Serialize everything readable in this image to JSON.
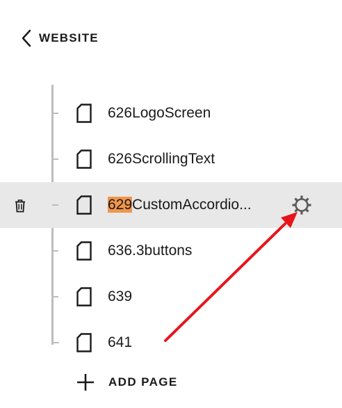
{
  "header": {
    "title": "WEBSITE",
    "back_icon": "chevron-left-icon"
  },
  "pages": [
    {
      "label": "626LogoScreen",
      "selected": false,
      "icon": "page-icon"
    },
    {
      "label": "626ScrollingText",
      "selected": false,
      "icon": "page-icon"
    },
    {
      "label_highlight": "629",
      "label_rest": "CustomAccordio...",
      "selected": true,
      "icon": "page-icon",
      "trash_icon": "trash-icon",
      "settings_icon": "gear-icon"
    },
    {
      "label": "636.3buttons",
      "selected": false,
      "icon": "page-icon"
    },
    {
      "label": "639",
      "selected": false,
      "icon": "page-icon"
    },
    {
      "label": "641",
      "selected": false,
      "icon": "page-icon"
    }
  ],
  "add_page": {
    "label": "ADD PAGE",
    "icon": "plus-icon"
  },
  "colors": {
    "selected_row": "#e8e8e8",
    "highlight": "#f0964a",
    "annotation_arrow": "#e8141b",
    "tree_line": "#bdbdbd"
  }
}
